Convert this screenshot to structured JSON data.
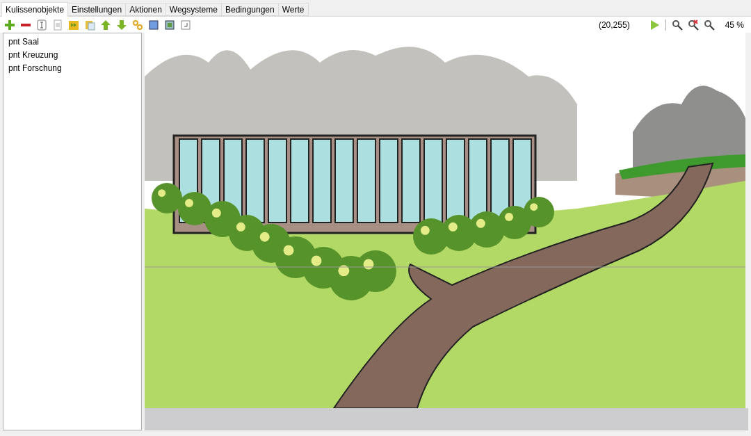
{
  "tabs": [
    {
      "label": "Kulissenobjekte",
      "selected": true
    },
    {
      "label": "Einstellungen",
      "selected": false
    },
    {
      "label": "Aktionen",
      "selected": false
    },
    {
      "label": "Wegsysteme",
      "selected": false
    },
    {
      "label": "Bedingungen",
      "selected": false
    },
    {
      "label": "Werte",
      "selected": false
    }
  ],
  "toolbar": {
    "coordinates": "(20,255)",
    "zoom": "45 %"
  },
  "objects": [
    {
      "label": "pnt Saal",
      "selected": false
    },
    {
      "label": "pnt Kreuzung",
      "selected": false
    },
    {
      "label": "pnt Forschung",
      "selected": false
    }
  ]
}
